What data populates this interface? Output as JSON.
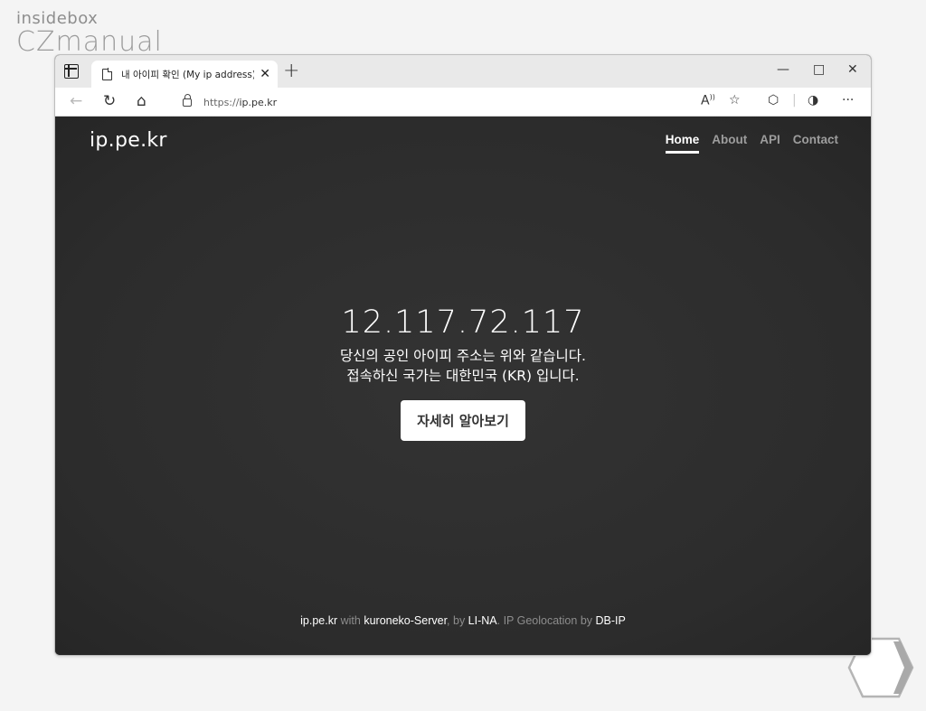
{
  "watermark": {
    "small": "insidebox",
    "big": "CZmanual"
  },
  "browser": {
    "tab_title": "내 아이피 확인 (My ip address) - ",
    "new_tab": "+",
    "url_protocol": "https://",
    "url_host": "ip.pe.kr",
    "window_controls": {
      "minimize": "—",
      "maximize": "□",
      "close": "✕"
    }
  },
  "site": {
    "brand": "ip.pe.kr",
    "nav": [
      {
        "label": "Home",
        "active": true
      },
      {
        "label": "About",
        "active": false
      },
      {
        "label": "API",
        "active": false
      },
      {
        "label": "Contact",
        "active": false
      }
    ]
  },
  "hero": {
    "ip": "12.117.72.117",
    "line1": "당신의 공인 아이피 주소는 위와 같습니다.",
    "line2": "접속하신 국가는 대한민국 (KR) 입니다.",
    "button": "자세히 알아보기"
  },
  "footer": {
    "site": "ip.pe.kr",
    "with": " with ",
    "server": "kuroneko-Server",
    "by": ", by ",
    "author": "LI-NA",
    "geo": ". IP Geolocation by ",
    "geo_provider": "DB-IP"
  },
  "colors": {
    "page_bg": "#2d2d2d",
    "nav_inactive": "#9d9d9d",
    "chrome": "#e9e9e9"
  }
}
